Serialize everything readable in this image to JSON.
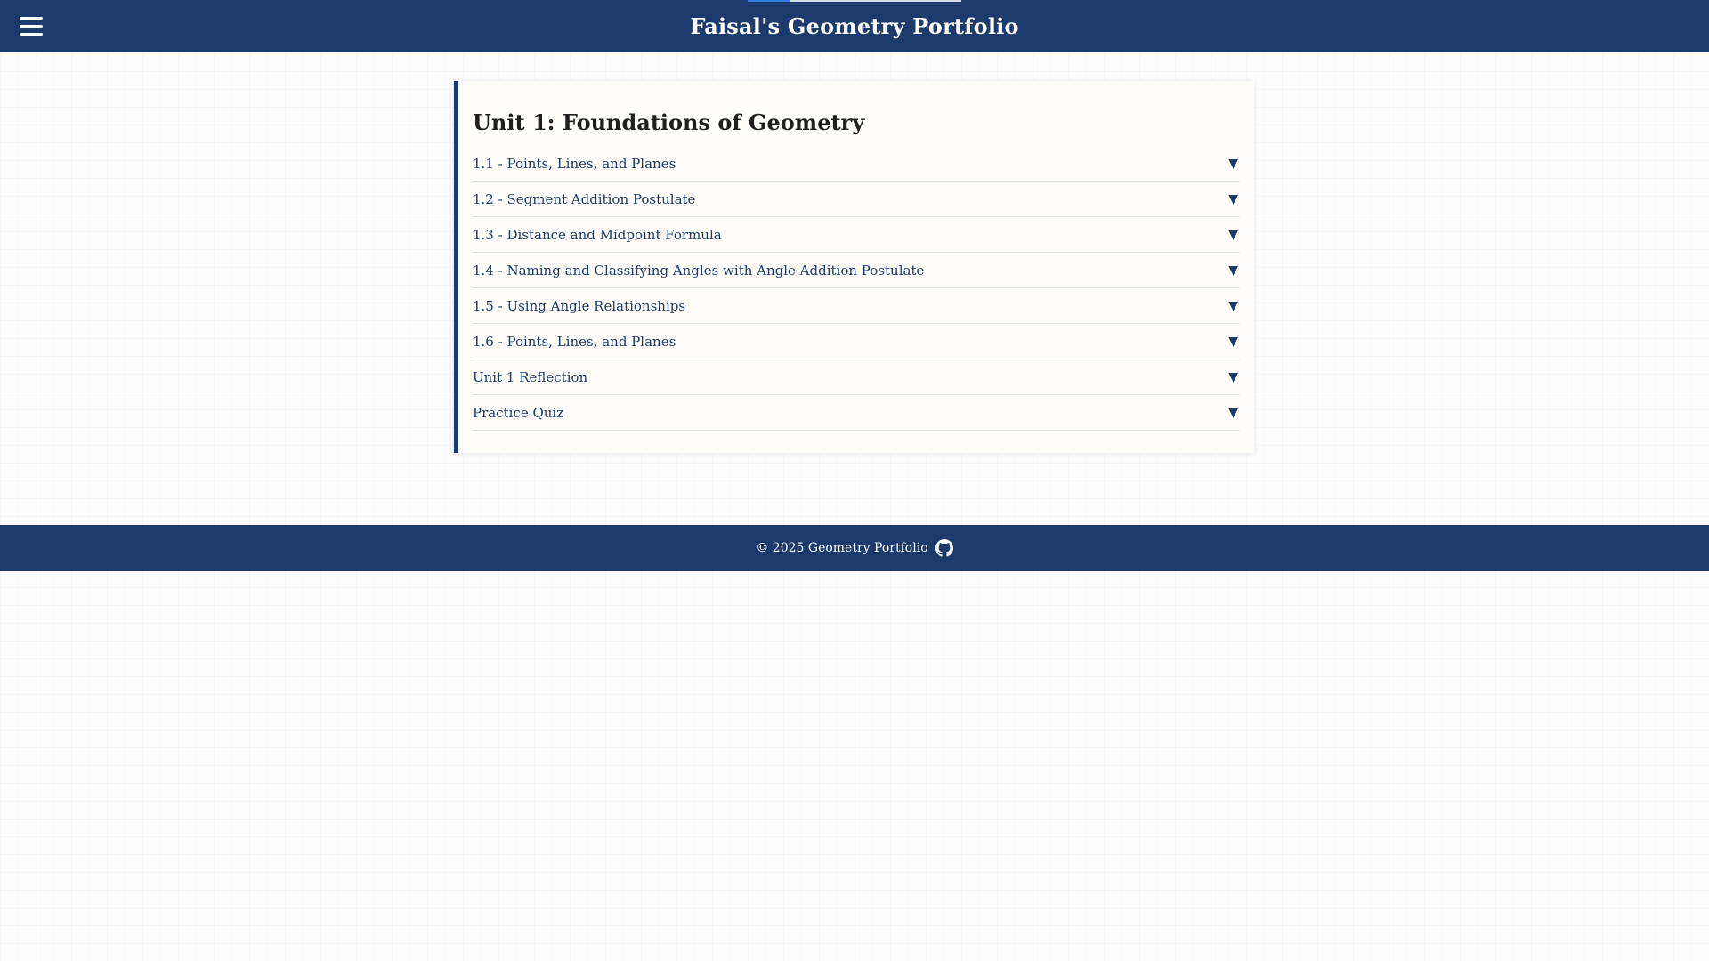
{
  "header": {
    "title": "Faisal's Geometry Portfolio",
    "menu_icon": "hamburger-menu-icon"
  },
  "unit": {
    "title": "Unit 1: Foundations of Geometry",
    "toggle_icon": "▼",
    "lessons": [
      {
        "label": "1.1 - Points, Lines, and Planes"
      },
      {
        "label": "1.2 - Segment Addition Postulate"
      },
      {
        "label": "1.3 - Distance and Midpoint Formula"
      },
      {
        "label": "1.4 - Naming and Classifying Angles with Angle Addition Postulate"
      },
      {
        "label": "1.5 - Using Angle Relationships"
      },
      {
        "label": "1.6 - Points, Lines, and Planes"
      },
      {
        "label": "Unit 1 Reflection"
      },
      {
        "label": "Practice Quiz"
      }
    ]
  },
  "footer": {
    "text": "© 2025 Geometry Portfolio",
    "icon": "github-icon"
  },
  "colors": {
    "primary": "#1c3a6b",
    "card_background": "#fffdf9",
    "accent": "#2f7ae5"
  }
}
